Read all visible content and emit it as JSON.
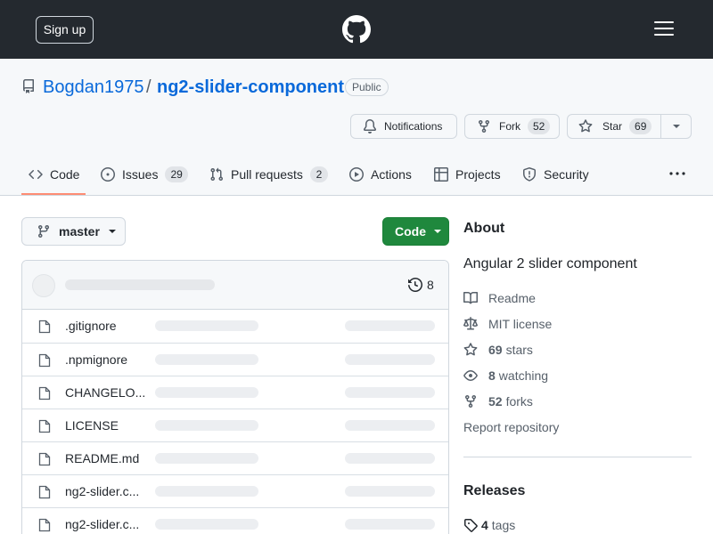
{
  "header": {
    "signup_label": "Sign up"
  },
  "repo": {
    "owner": "Bogdan1975",
    "separator": "/",
    "name": "ng2-slider-component",
    "visibility": "Public"
  },
  "actions": {
    "notifications_label": "Notifications",
    "fork_label": "Fork",
    "fork_count": "52",
    "star_label": "Star",
    "star_count": "69"
  },
  "tabs": [
    {
      "label": "Code",
      "icon": "code-icon"
    },
    {
      "label": "Issues",
      "count": "29",
      "icon": "issue-icon"
    },
    {
      "label": "Pull requests",
      "count": "2",
      "icon": "pull-request-icon"
    },
    {
      "label": "Actions",
      "icon": "play-icon"
    },
    {
      "label": "Projects",
      "icon": "table-icon"
    },
    {
      "label": "Security",
      "icon": "shield-icon"
    }
  ],
  "branch": {
    "name": "master"
  },
  "code_button": {
    "label": "Code"
  },
  "commits": {
    "count": "8"
  },
  "files": [
    {
      "name": ".gitignore"
    },
    {
      "name": ".npmignore"
    },
    {
      "name": "CHANGELO..."
    },
    {
      "name": "LICENSE"
    },
    {
      "name": "README.md"
    },
    {
      "name": "ng2-slider.c..."
    },
    {
      "name": "ng2-slider.c..."
    }
  ],
  "about": {
    "title": "About",
    "description": "Angular 2 slider component",
    "readme": "Readme",
    "license": "MIT license",
    "stars_count": "69",
    "stars_label": "stars",
    "watching_count": "8",
    "watching_label": "watching",
    "forks_count": "52",
    "forks_label": "forks",
    "report": "Report repository"
  },
  "releases": {
    "title": "Releases",
    "tags_count": "4",
    "tags_label": "tags"
  },
  "colors": {
    "header_bg": "#24292f",
    "link": "#0969da",
    "code_button": "#1f883d",
    "tab_underline": "#fd8c73"
  }
}
